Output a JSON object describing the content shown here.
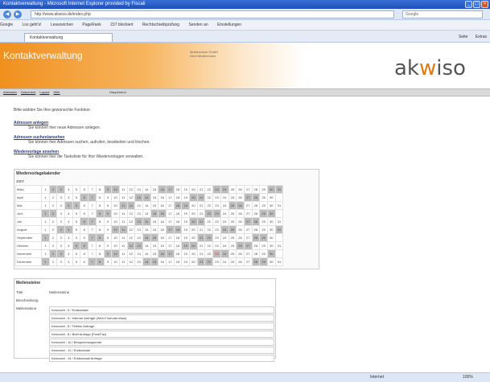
{
  "window": {
    "title": "Kontaktverwaltung - Microsoft Internet Explorer provided by Fiscali",
    "min": "_",
    "max": "□",
    "close": "×"
  },
  "browser": {
    "address": "http://www.akwiso.de/index.php",
    "search_placeholder": "Google",
    "tab_label": "Kontaktverwaltung",
    "google_items": [
      "Google",
      "Los geht's!",
      "Lesezeichen",
      "PageRank",
      "237 blockiert",
      "Rechtschreibprüfung",
      "Senden an",
      "Einstellungen"
    ],
    "tab_tools": [
      "Seite",
      "Extras"
    ],
    "status_zone": "Internet",
    "status_zoom": "100%"
  },
  "header": {
    "title": "Kontaktverwaltung",
    "company_line1": "Mustermann GmbH",
    "company_line2": "Gerd Mustermann",
    "logo_a": "ak",
    "logo_w": "w",
    "logo_b": "iso"
  },
  "menu": {
    "items": [
      "Adressen",
      "Dokument",
      "Layout",
      "Hilfe"
    ],
    "active": "Hauptmenü"
  },
  "intro": "Bitte wählen Sie Ihre gewünschte Funktion:",
  "sections": [
    {
      "title": "Adressen anlegen",
      "desc": "Sie können hier neue Adressen anlegen."
    },
    {
      "title": "Adressen suchen/ansehen",
      "desc": "Sie können hier Adressen suchen, aufrufen, bearbeiten und löschen."
    },
    {
      "title": "Wiedervorlage ansehen",
      "desc": "Sie können hier die Tasksliste für Ihre Wiedervorlagen verwalten."
    }
  ],
  "calendar": {
    "title": "Wiedervorlagekalender",
    "year": "2007",
    "months": [
      {
        "name": "März",
        "days": 31,
        "start": 4
      },
      {
        "name": "April",
        "days": 30,
        "start": 0
      },
      {
        "name": "Mai",
        "days": 31,
        "start": 2
      },
      {
        "name": "Juni",
        "days": 30,
        "start": 5
      },
      {
        "name": "Juli",
        "days": 31,
        "start": 0
      },
      {
        "name": "August",
        "days": 31,
        "start": 3
      },
      {
        "name": "September",
        "days": 30,
        "start": 6
      },
      {
        "name": "Oktober",
        "days": 31,
        "start": 1
      },
      {
        "name": "November",
        "days": 30,
        "start": 4
      },
      {
        "name": "Dezember",
        "days": 31,
        "start": 6
      }
    ],
    "highlight": {
      "month": 8,
      "day": 23
    }
  },
  "milestones": {
    "title": "Meilensteine",
    "title_label": "Titel",
    "title_value": "Meilensteine",
    "desc_label": "Beschreibung",
    "ms_label": "Meilensteine",
    "items": [
      "Kennzahl : 0 / Erstkontakt",
      "Kennzahl : 5 / Interner Anfrage (Web-Formular etwa)",
      "Kennzahl : 8 / Telefon Anfrage",
      "Kennzahl : 8 / Brief Anfrage (Post/Fax)",
      "Kennzahl : 10 / Besprechungsende",
      "Kennzahl : 12 / Erstkontakt",
      "Kennzahl : 14 / Erstkontakt Anfrage"
    ]
  }
}
